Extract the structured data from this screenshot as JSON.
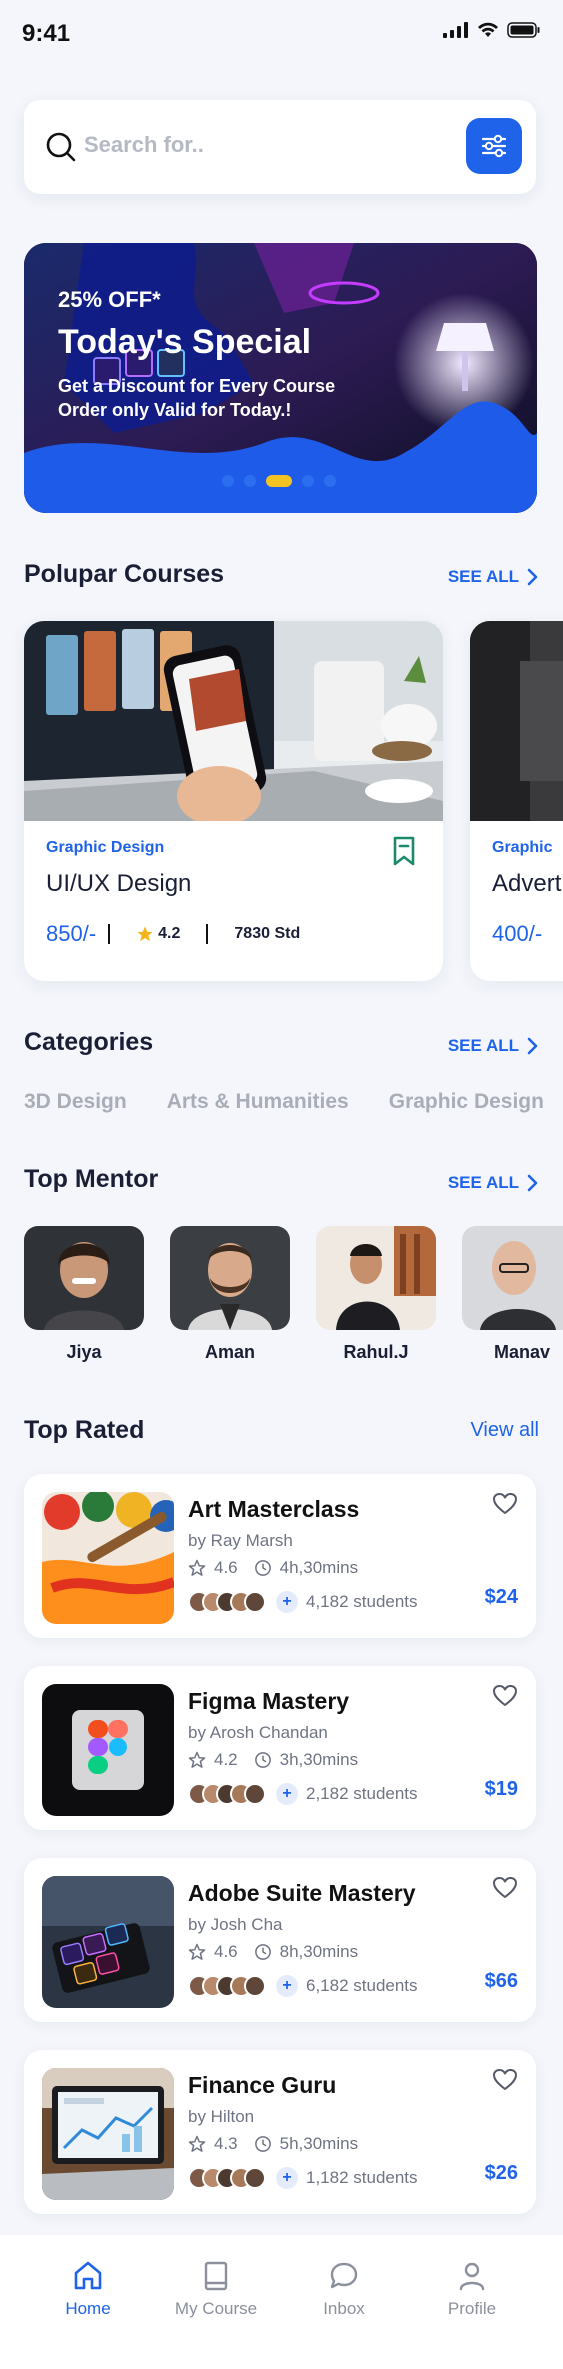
{
  "status": {
    "time": "9:41"
  },
  "search": {
    "placeholder": "Search for.."
  },
  "banner": {
    "discount": "25% OFF*",
    "title": "Today's Special",
    "subtitle": "Get a Discount for Every Course Order only Valid for Today.!",
    "pages": 5,
    "active_page": 3
  },
  "popular": {
    "title": "Polupar Courses",
    "see_all": "SEE ALL",
    "courses": [
      {
        "category": "Graphic Design",
        "name": "UI/UX Design",
        "price": "850/-",
        "rating": "4.2",
        "students": "7830 Std"
      },
      {
        "category": "Graphic",
        "name": "Advert",
        "price": "400/-"
      }
    ]
  },
  "categories": {
    "title": "Categories",
    "see_all": "SEE ALL",
    "items": [
      "3D Design",
      "Arts & Humanities",
      "Graphic Design"
    ]
  },
  "mentors": {
    "title": "Top Mentor",
    "see_all": "SEE ALL",
    "items": [
      "Jiya",
      "Aman",
      "Rahul.J",
      "Manav"
    ]
  },
  "top_rated": {
    "title": "Top Rated",
    "view_all": "View all",
    "items": [
      {
        "title": "Art Masterclass",
        "author": "by Ray Marsh",
        "rating": "4.6",
        "duration": "4h,30mins",
        "students": "4,182 students",
        "price": "$24"
      },
      {
        "title": "Figma Mastery",
        "author": "by Arosh Chandan",
        "rating": "4.2",
        "duration": "3h,30mins",
        "students": "2,182 students",
        "price": "$19"
      },
      {
        "title": "Adobe Suite Mastery",
        "author": "by Josh Cha",
        "rating": "4.6",
        "duration": "8h,30mins",
        "students": "6,182 students",
        "price": "$66"
      },
      {
        "title": "Finance Guru",
        "author": "by Hilton",
        "rating": "4.3",
        "duration": "5h,30mins",
        "students": "1,182 students",
        "price": "$26"
      }
    ]
  },
  "tabbar": {
    "items": [
      {
        "label": "Home",
        "icon": "home-icon",
        "active": true
      },
      {
        "label": "My Course",
        "icon": "book-icon"
      },
      {
        "label": "Inbox",
        "icon": "chat-icon"
      },
      {
        "label": "Profile",
        "icon": "user-icon"
      }
    ]
  },
  "colors": {
    "accent": "#1e63e9",
    "star": "#f3b51b",
    "text": "#1a1f36",
    "muted": "#a9adb8"
  }
}
